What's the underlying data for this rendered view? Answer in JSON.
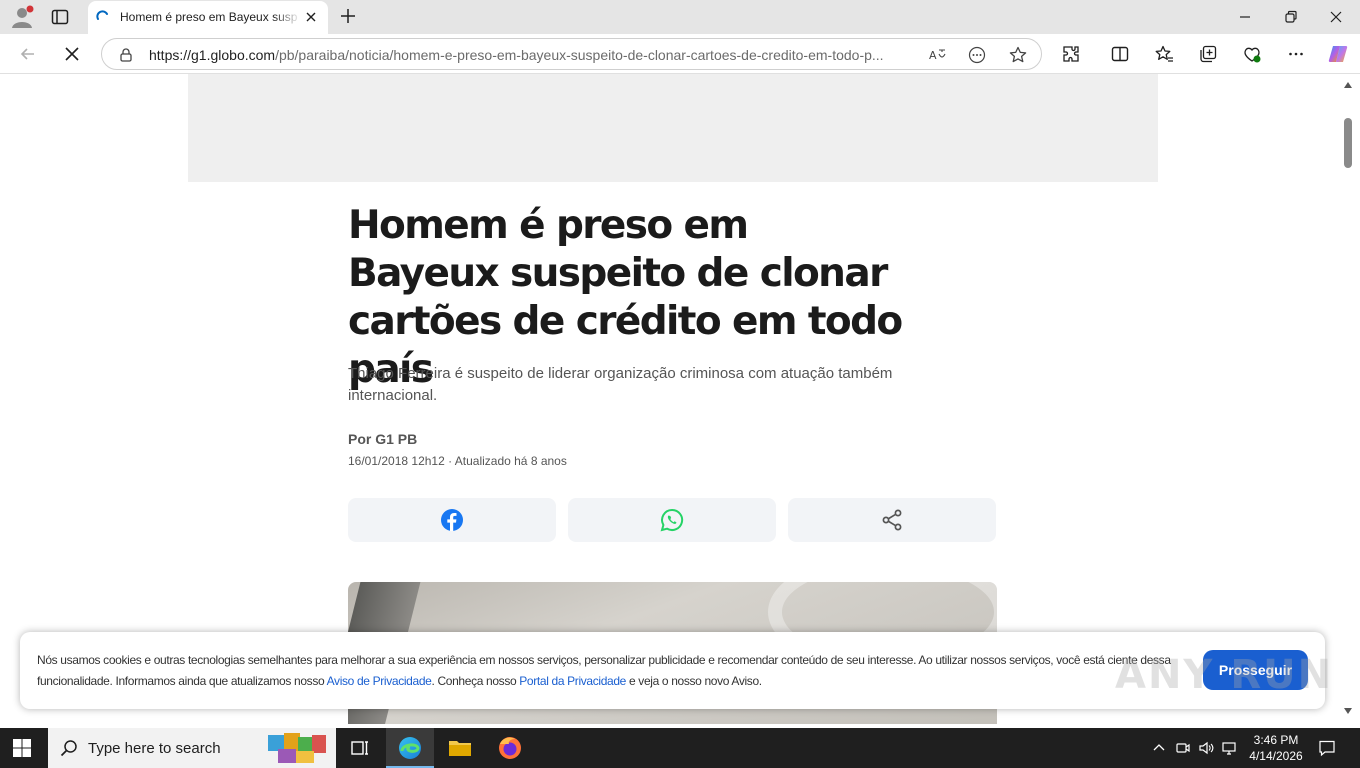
{
  "browser": {
    "tab": {
      "title": "Homem é preso em Bayeux suspeito de clonar cartões de crédito em todo país"
    },
    "address_bar": {
      "url_host": "https://g1.globo.com",
      "url_path": "/pb/paraiba/noticia/homem-e-preso-em-bayeux-suspeito-de-clonar-cartoes-de-credito-em-todo-p..."
    },
    "icons": [
      "profile-icon",
      "tab-actions-icon",
      "loading-spinner-icon",
      "close-icon",
      "new-tab-icon",
      "minimize-icon",
      "restore-icon",
      "close-window-icon",
      "back-icon",
      "stop-loading-icon",
      "lock-icon",
      "read-aloud-icon",
      "more-options-icon",
      "favorite-star-icon",
      "extensions-icon",
      "split-screen-icon",
      "favorites-icon",
      "collections-icon",
      "browser-essentials-icon",
      "settings-menu-icon",
      "copilot-icon"
    ]
  },
  "article": {
    "headline": "Homem é preso em Bayeux suspeito de clonar cartões de crédito em todo país",
    "subtitle": "Thiago Ferreira é suspeito de liderar organização criminosa com atuação também internacional.",
    "byline": "Por G1 PB",
    "dateline": "16/01/2018 12h12 · Atualizado há 8 anos",
    "share": [
      {
        "name": "facebook",
        "color": "#1877f2"
      },
      {
        "name": "whatsapp",
        "color": "#25d366"
      },
      {
        "name": "share",
        "color": "#555555"
      }
    ]
  },
  "cookie_banner": {
    "text_1": "Nós usamos cookies e outras tecnologias semelhantes para melhorar a sua experiência em nossos serviços, personalizar publicidade e recomendar conteúdo de seu interesse. Ao utilizar nossos serviços, você está ciente dessa funcionalidade. Informamos ainda que atualizamos nosso ",
    "link_privacy": "Aviso de Privacidade",
    "text_2": ". Conheça nosso ",
    "link_portal": "Portal da Privacidade",
    "text_3": " e veja o nosso novo Aviso.",
    "button": "Prosseguir",
    "accent": "#1a5fd0"
  },
  "watermark": "ANY RUN",
  "taskbar": {
    "search_placeholder": "Type here to search",
    "time": "3:46 PM",
    "date": "4/14/2026"
  }
}
